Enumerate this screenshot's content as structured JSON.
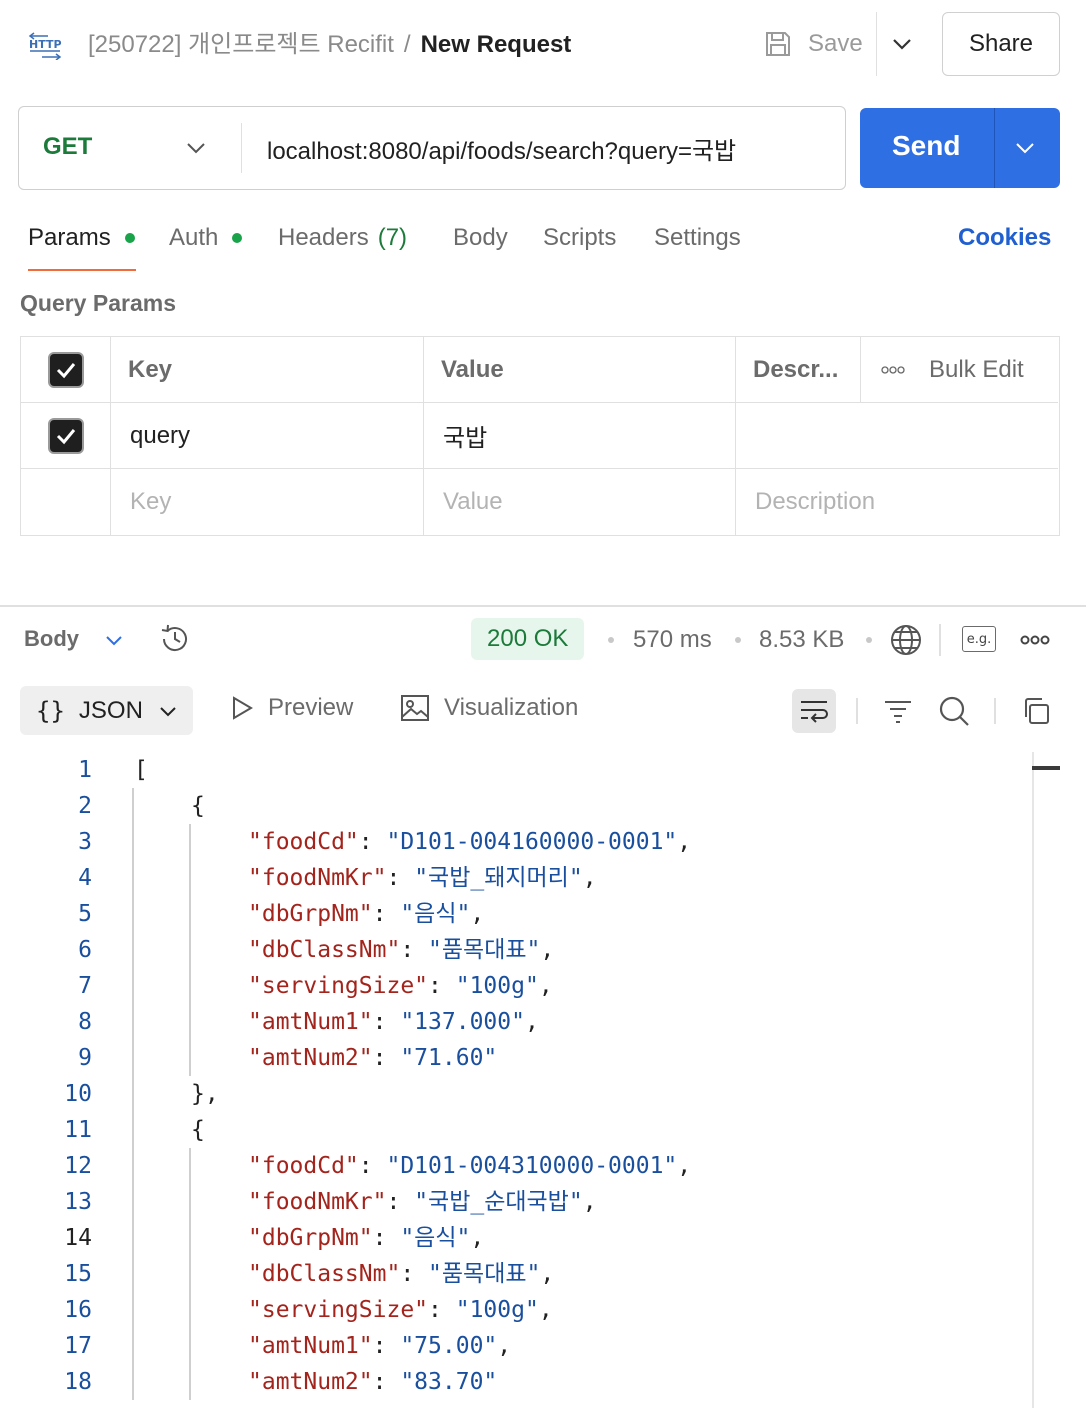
{
  "header": {
    "collection": "[250722] 개인프로젝트 Recifit",
    "separator": "/",
    "request_name": "New Request",
    "save_label": "Save",
    "share_label": "Share"
  },
  "request": {
    "method": "GET",
    "url": "localhost:8080/api/foods/search?query=국밥",
    "send_label": "Send"
  },
  "tabs": {
    "params": "Params",
    "auth": "Auth",
    "headers": "Headers",
    "headers_count": "(7)",
    "body": "Body",
    "scripts": "Scripts",
    "settings": "Settings",
    "cookies": "Cookies"
  },
  "query_params": {
    "title": "Query Params",
    "headers": {
      "key": "Key",
      "value": "Value",
      "description": "Descr...",
      "bulk_edit": "Bulk Edit"
    },
    "rows": [
      {
        "checked": true,
        "key": "query",
        "value": "국밥",
        "description": ""
      }
    ],
    "placeholders": {
      "key": "Key",
      "value": "Value",
      "description": "Description"
    }
  },
  "response": {
    "section_label": "Body",
    "status": "200 OK",
    "time": "570 ms",
    "size": "8.53 KB",
    "example_label": "e.g.",
    "format_label": "JSON",
    "preview_label": "Preview",
    "visualization_label": "Visualization",
    "current_line": 14,
    "lines": [
      {
        "n": 1,
        "indent": 0,
        "parts": [
          {
            "t": "p",
            "v": "["
          }
        ]
      },
      {
        "n": 2,
        "indent": 1,
        "parts": [
          {
            "t": "p",
            "v": "{"
          }
        ]
      },
      {
        "n": 3,
        "indent": 2,
        "parts": [
          {
            "t": "k",
            "v": "\"foodCd\""
          },
          {
            "t": "p",
            "v": ": "
          },
          {
            "t": "s",
            "v": "\"D101-004160000-0001\""
          },
          {
            "t": "p",
            "v": ","
          }
        ]
      },
      {
        "n": 4,
        "indent": 2,
        "parts": [
          {
            "t": "k",
            "v": "\"foodNmKr\""
          },
          {
            "t": "p",
            "v": ": "
          },
          {
            "t": "s",
            "v": "\"국밥_돼지머리\""
          },
          {
            "t": "p",
            "v": ","
          }
        ]
      },
      {
        "n": 5,
        "indent": 2,
        "parts": [
          {
            "t": "k",
            "v": "\"dbGrpNm\""
          },
          {
            "t": "p",
            "v": ": "
          },
          {
            "t": "s",
            "v": "\"음식\""
          },
          {
            "t": "p",
            "v": ","
          }
        ]
      },
      {
        "n": 6,
        "indent": 2,
        "parts": [
          {
            "t": "k",
            "v": "\"dbClassNm\""
          },
          {
            "t": "p",
            "v": ": "
          },
          {
            "t": "s",
            "v": "\"품목대표\""
          },
          {
            "t": "p",
            "v": ","
          }
        ]
      },
      {
        "n": 7,
        "indent": 2,
        "parts": [
          {
            "t": "k",
            "v": "\"servingSize\""
          },
          {
            "t": "p",
            "v": ": "
          },
          {
            "t": "s",
            "v": "\"100g\""
          },
          {
            "t": "p",
            "v": ","
          }
        ]
      },
      {
        "n": 8,
        "indent": 2,
        "parts": [
          {
            "t": "k",
            "v": "\"amtNum1\""
          },
          {
            "t": "p",
            "v": ": "
          },
          {
            "t": "s",
            "v": "\"137.000\""
          },
          {
            "t": "p",
            "v": ","
          }
        ]
      },
      {
        "n": 9,
        "indent": 2,
        "parts": [
          {
            "t": "k",
            "v": "\"amtNum2\""
          },
          {
            "t": "p",
            "v": ": "
          },
          {
            "t": "s",
            "v": "\"71.60\""
          }
        ]
      },
      {
        "n": 10,
        "indent": 1,
        "parts": [
          {
            "t": "p",
            "v": "},"
          }
        ]
      },
      {
        "n": 11,
        "indent": 1,
        "parts": [
          {
            "t": "p",
            "v": "{"
          }
        ]
      },
      {
        "n": 12,
        "indent": 2,
        "parts": [
          {
            "t": "k",
            "v": "\"foodCd\""
          },
          {
            "t": "p",
            "v": ": "
          },
          {
            "t": "s",
            "v": "\"D101-004310000-0001\""
          },
          {
            "t": "p",
            "v": ","
          }
        ]
      },
      {
        "n": 13,
        "indent": 2,
        "parts": [
          {
            "t": "k",
            "v": "\"foodNmKr\""
          },
          {
            "t": "p",
            "v": ": "
          },
          {
            "t": "s",
            "v": "\"국밥_순대국밥\""
          },
          {
            "t": "p",
            "v": ","
          }
        ]
      },
      {
        "n": 14,
        "indent": 2,
        "parts": [
          {
            "t": "k",
            "v": "\"dbGrpNm\""
          },
          {
            "t": "p",
            "v": ": "
          },
          {
            "t": "s",
            "v": "\"음식\""
          },
          {
            "t": "p",
            "v": ","
          }
        ]
      },
      {
        "n": 15,
        "indent": 2,
        "parts": [
          {
            "t": "k",
            "v": "\"dbClassNm\""
          },
          {
            "t": "p",
            "v": ": "
          },
          {
            "t": "s",
            "v": "\"품목대표\""
          },
          {
            "t": "p",
            "v": ","
          }
        ]
      },
      {
        "n": 16,
        "indent": 2,
        "parts": [
          {
            "t": "k",
            "v": "\"servingSize\""
          },
          {
            "t": "p",
            "v": ": "
          },
          {
            "t": "s",
            "v": "\"100g\""
          },
          {
            "t": "p",
            "v": ","
          }
        ]
      },
      {
        "n": 17,
        "indent": 2,
        "parts": [
          {
            "t": "k",
            "v": "\"amtNum1\""
          },
          {
            "t": "p",
            "v": ": "
          },
          {
            "t": "s",
            "v": "\"75.00\""
          },
          {
            "t": "p",
            "v": ","
          }
        ]
      },
      {
        "n": 18,
        "indent": 2,
        "parts": [
          {
            "t": "k",
            "v": "\"amtNum2\""
          },
          {
            "t": "p",
            "v": ": "
          },
          {
            "t": "s",
            "v": "\"83.70\""
          }
        ]
      }
    ]
  },
  "icons": {
    "http": "http-icon",
    "save": "save-icon",
    "history": "history-icon",
    "globe": "globe-icon",
    "more": "more-icon",
    "wrap": "wrap-lines-icon",
    "filter": "filter-icon",
    "search": "search-icon",
    "copy": "copy-icon"
  },
  "colors": {
    "send": "#2f6fe4",
    "method_get": "#1c7a3a",
    "tab_underline": "#f26b3a",
    "status_ok_bg": "#e7f6ec",
    "json_key": "#a3241c",
    "json_string": "#1a4f9e"
  }
}
